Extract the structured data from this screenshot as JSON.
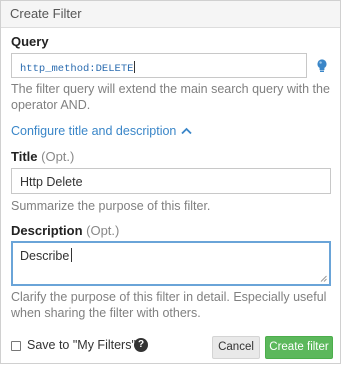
{
  "dialog": {
    "title": "Create Filter",
    "query": {
      "label": "Query",
      "value": "http_method:DELETE",
      "help": "The filter query will extend the main search query with the operator AND."
    },
    "configure_link": "Configure title and description",
    "title_field": {
      "label": "Title",
      "optional": "(Opt.)",
      "value": "Http Delete",
      "help": "Summarize the purpose of this filter."
    },
    "description_field": {
      "label": "Description",
      "optional": "(Opt.)",
      "value": "Describe",
      "help": "Clarify the purpose of this filter in detail. Especially useful when sharing the filter with others."
    },
    "save_checkbox": {
      "label": "Save to \"My Filters\"",
      "checked": false
    },
    "help_icon_glyph": "?",
    "cancel_label": "Cancel",
    "create_label": "Create filter"
  },
  "colors": {
    "link": "#3a86c8",
    "primary_button": "#5cb85c",
    "focus_border": "#6aa4d8",
    "bulb": "#3a86c8"
  },
  "icons": {
    "bulb": "lightbulb-icon",
    "chevron": "chevron-up-icon",
    "help": "question-circle-icon"
  }
}
